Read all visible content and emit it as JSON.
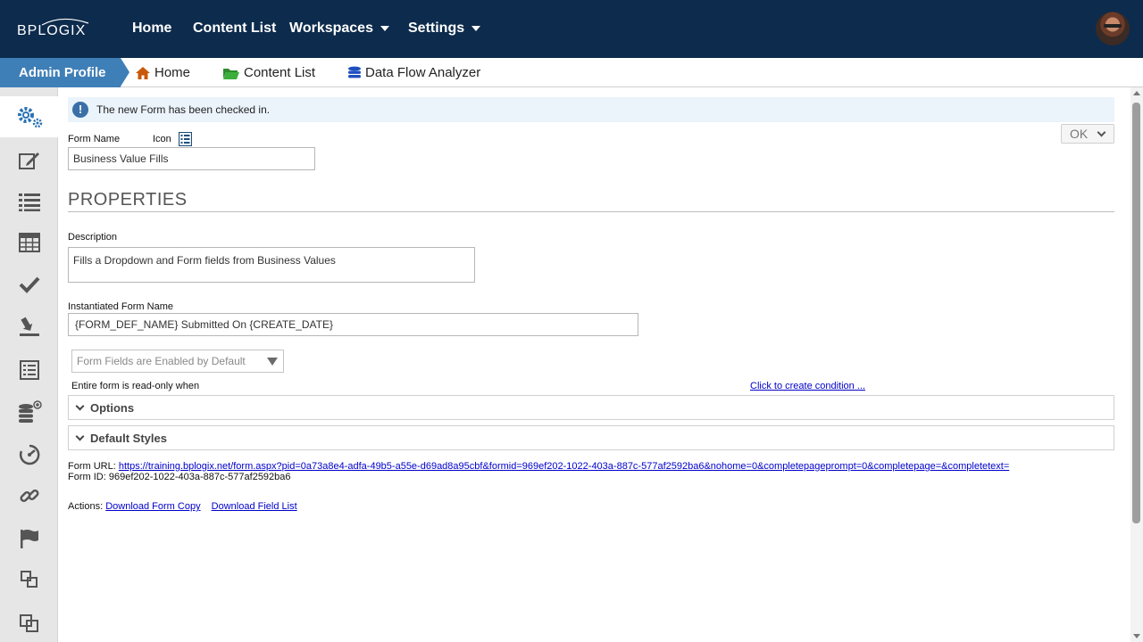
{
  "app": {
    "logo_text": "BPLOGIX",
    "topnav": [
      {
        "label": "Home"
      },
      {
        "label": "Content List"
      },
      {
        "label": "Workspaces"
      },
      {
        "label": "Settings"
      }
    ]
  },
  "subbar": {
    "active_tab": "Admin Profile",
    "links": [
      {
        "label": "Home",
        "icon": "home-icon"
      },
      {
        "label": "Content List",
        "icon": "folder-icon"
      },
      {
        "label": "Data Flow Analyzer",
        "icon": "database-icon"
      }
    ]
  },
  "sidebar": {
    "items": [
      {
        "icon": "gears-icon",
        "active": true
      },
      {
        "icon": "edit-icon"
      },
      {
        "icon": "list-icon"
      },
      {
        "icon": "table-icon"
      },
      {
        "icon": "check-icon"
      },
      {
        "icon": "download-icon"
      },
      {
        "icon": "form-list-icon"
      },
      {
        "icon": "database-add-icon"
      },
      {
        "icon": "dashboard-icon"
      },
      {
        "icon": "link-icon"
      },
      {
        "icon": "flag-icon"
      },
      {
        "icon": "duplicate-icon"
      },
      {
        "icon": "copy-icon"
      }
    ]
  },
  "colors": {
    "topnav_bg": "#0d2b4c",
    "admin_tab_bg": "#3f7fb7",
    "notice_bg": "#ebf3fb",
    "link": "#0000cc"
  },
  "form": {
    "notice": "The new Form has been checked in.",
    "ok_label": "OK",
    "form_name_label": "Form Name",
    "icon_label": "Icon",
    "form_name_value": "Business Value Fills",
    "section_title": "PROPERTIES",
    "description_label": "Description",
    "description_value": "Fills a Dropdown and Form fields from Business Values",
    "instantiated_label": "Instantiated Form Name",
    "instantiated_value": "{FORM_DEF_NAME} Submitted On {CREATE_DATE}",
    "fields_select": "Form Fields are Enabled by Default",
    "readonly_label": "Entire form is read-only when",
    "condition_link": "Click to create condition ...",
    "panels": [
      {
        "title": "Options"
      },
      {
        "title": "Default Styles"
      }
    ],
    "url_label": "Form URL:",
    "url_value": "https://training.bplogix.net/form.aspx?pid=0a73a8e4-adfa-49b5-a55e-d69ad8a95cbf&formid=969ef202-1022-403a-887c-577af2592ba6&nohome=0&completepageprompt=0&completepage=&completetext=",
    "form_id_label": "Form ID:",
    "form_id_value": "969ef202-1022-403a-887c-577af2592ba6",
    "actions_label": "Actions:",
    "action_download_copy": "Download Form Copy",
    "action_download_fields": "Download Field List"
  }
}
